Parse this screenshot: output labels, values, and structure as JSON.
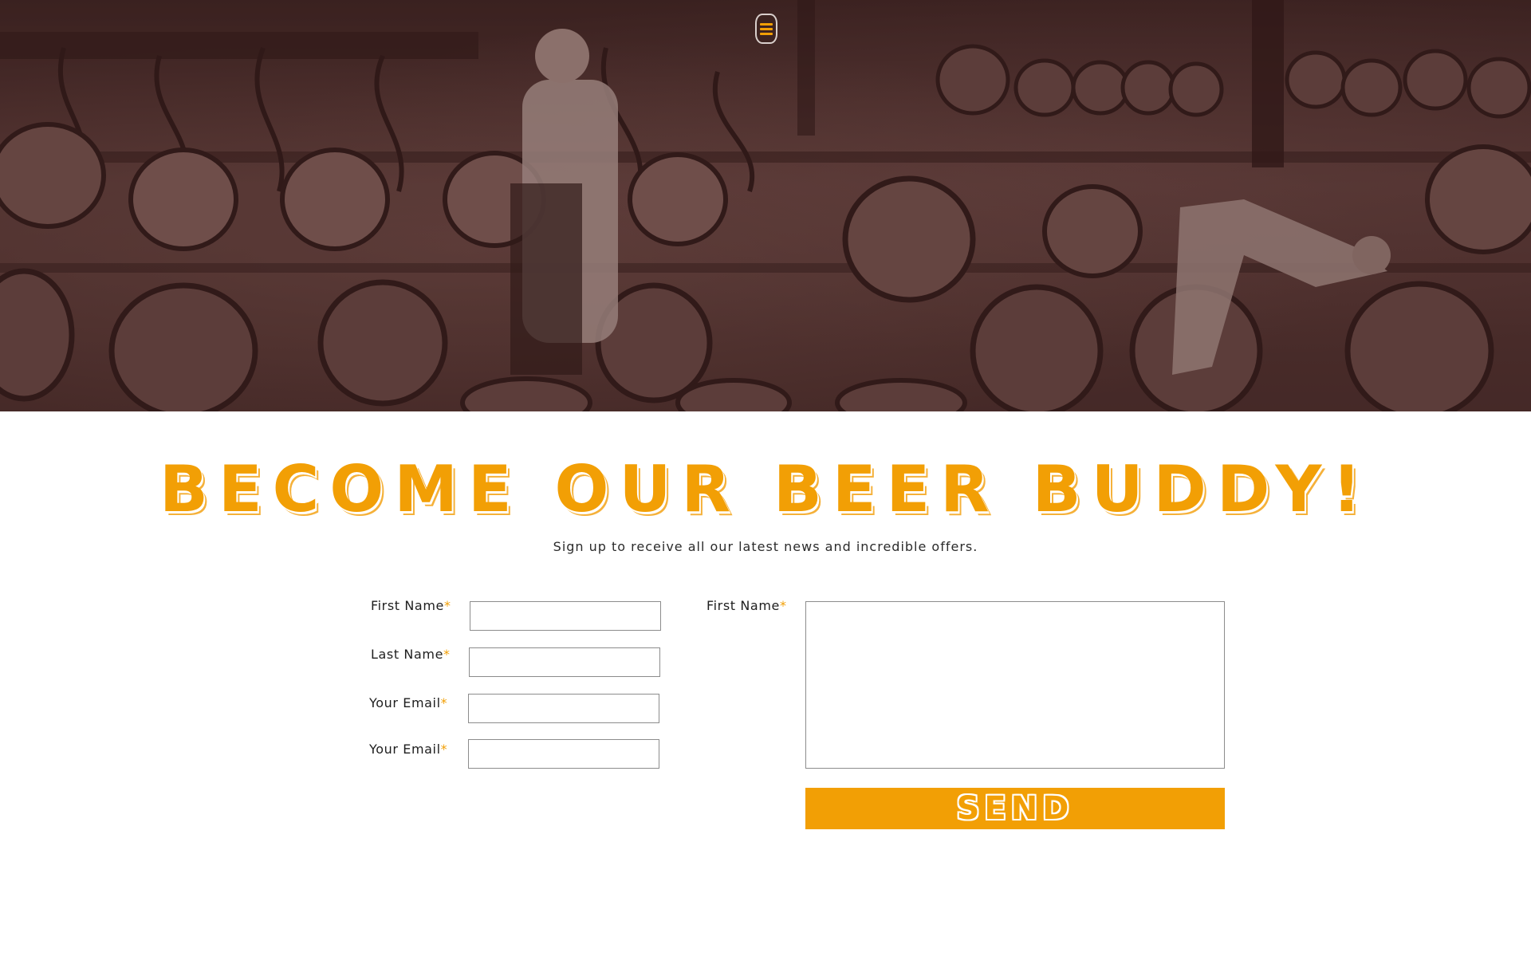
{
  "colors": {
    "accent": "#f29f05",
    "hero_tint": "#4a2f2c",
    "text": "#1e1e1e",
    "input_border": "#8c8c8c"
  },
  "header": {
    "menu_icon": "hamburger-menu-icon"
  },
  "hero": {
    "image_subject": "sepia photograph of brewery workers with beer barrels"
  },
  "signup": {
    "headline": "BECOME OUR BEER BUDDY!",
    "subtitle": "Sign up to receive all our latest news and incredible offers.",
    "required_marker": "*",
    "fields_left": [
      {
        "label": "First Name",
        "value": "",
        "placeholder": ""
      },
      {
        "label": "Last Name",
        "value": "",
        "placeholder": ""
      },
      {
        "label": "Your Email",
        "value": "",
        "placeholder": ""
      },
      {
        "label": "Your Email",
        "value": "",
        "placeholder": ""
      }
    ],
    "message_field": {
      "label": "First Name",
      "value": "",
      "placeholder": ""
    },
    "send_label": "SEND"
  }
}
